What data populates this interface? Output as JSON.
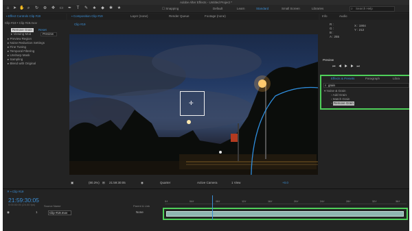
{
  "app": {
    "title": "Adobe After Effects - Untitled Project *"
  },
  "toolbar": {
    "snapping_label": "Snapping",
    "workspaces": [
      "Default",
      "Learn",
      "Standard",
      "Small Screen",
      "Libraries"
    ],
    "active_workspace": "Standard",
    "search_placeholder": "Search Help"
  },
  "left_panel": {
    "tab_label": "Effect Controls Clip #19",
    "layer_path": "Clip #19 • Clip #19.mov",
    "effect_name": "Remove Grain",
    "reset_label": "Reset",
    "viewing_mode_label": "Viewing Mod",
    "viewing_mode_value": "Preview",
    "items": [
      "Preview Region",
      "Noise Reduction Settings",
      "Fine Tuning",
      "Temporal Filtering",
      "Unsharp Mask",
      "Sampling",
      "Blend with Original"
    ]
  },
  "center_tabs": {
    "composition": "Composition Clip #19",
    "layer": "Layer (none)",
    "render_queue": "Render Queue",
    "footage": "Footage (none)",
    "comp_subtab": "Clip #19"
  },
  "viewer_bar": {
    "zoom": "(80.3%)",
    "timecode": "21:59:30:05",
    "resolution": "Quarter",
    "camera": "Active Camera",
    "views": "1 View",
    "exposure": "+0.0"
  },
  "info_panel": {
    "tab_info": "Info",
    "tab_audio": "Audio",
    "r": "R :",
    "g": "G :",
    "b": "B :",
    "a": "A :",
    "a_value": "255",
    "x": "X : 1904",
    "y": "Y : 212"
  },
  "preview_panel": {
    "title": "Preview",
    "controls": "⏮ ◀ ▶ ▶ ⏭"
  },
  "effects_panel": {
    "tab_label": "Effects & Presets",
    "tab_paragraph": "Paragraph",
    "tab_libraries": "Libra",
    "search_value": "grain",
    "category": "Noise & Grain",
    "items": [
      "Add Grain",
      "Match Grain",
      "Remove Grain"
    ],
    "selected": "Remove Grain"
  },
  "timeline": {
    "tab_label": "Clip #19",
    "timecode": "21:59:30:05",
    "frame_info": "0:00:00:00 (24.00 fps)",
    "col_source_name": "Source Name",
    "col_parent": "Parent & Link",
    "layer_index": "1",
    "layer_name": "Clip #19.mov",
    "parent_value": "None",
    "ticks": [
      "0:f",
      "04:f",
      "08:f",
      "12:f",
      "16:f",
      "20:f",
      "24:f",
      "28:f",
      "32:f",
      "36:f"
    ]
  },
  "colors": {
    "accent": "#3b8fd6",
    "highlight": "#4fd05a",
    "layer_bar": "#8fb5b0"
  },
  "icons": [
    "home-icon",
    "selection-icon",
    "hand-icon",
    "zoom-icon",
    "rotate-icon",
    "camera-icon",
    "pen-icon",
    "text-icon",
    "brush-icon",
    "stamp-icon",
    "eraser-icon",
    "puppet-icon",
    "search-icon"
  ]
}
